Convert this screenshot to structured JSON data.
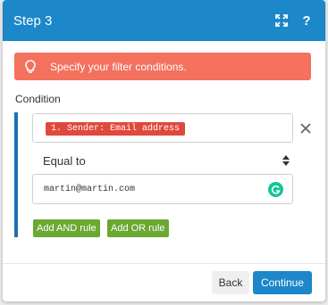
{
  "header": {
    "title": "Step 3",
    "help_label": "?",
    "expand_icon": "expand-icon",
    "background_color": "#1c87c9"
  },
  "hint": {
    "text": "Specify your filter conditions.",
    "icon": "lightbulb-icon",
    "background_color": "#f4715e"
  },
  "condition": {
    "label": "Condition",
    "field_tag": "1. Sender: Email address",
    "operator": "Equal to",
    "value": "martin@martin.com",
    "remove_icon": "close-icon",
    "grammarly_icon": "grammarly-icon"
  },
  "rule_buttons": {
    "and_label": "Add AND rule",
    "or_label": "Add OR rule",
    "color": "#6aa832"
  },
  "footer": {
    "back_label": "Back",
    "continue_label": "Continue"
  }
}
